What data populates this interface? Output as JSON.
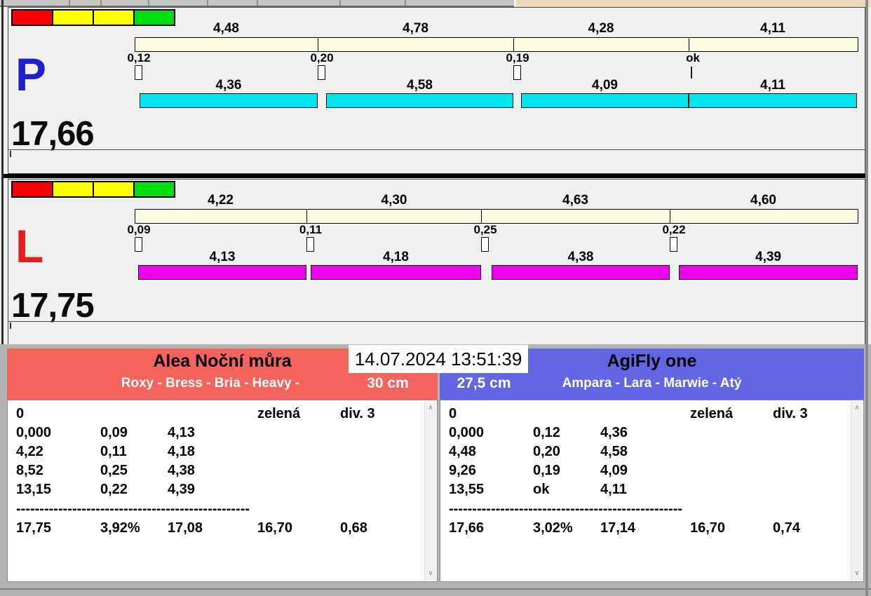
{
  "meta": {
    "datetime": "14.07.2024 13:51:39"
  },
  "icons": {
    "scroll_up": "∧",
    "scroll_down": "∨"
  },
  "colors": {
    "cream_bar": "#fdfce1",
    "cyan_bar": "#00e4ee",
    "magenta_bar": "#ee00ee",
    "team_left_header": "#f4635c",
    "team_right_header": "#6366e3",
    "p_label": "#1f1fcc",
    "l_label": "#e01f1f",
    "traffic": [
      "#f70000",
      "#ffff00",
      "#ffff00",
      "#00dd11"
    ],
    "top_strip_tan": "#ecd8ba"
  },
  "run_panels": [
    {
      "label": "P",
      "total": "17,66",
      "total_value": 17.66,
      "bar_color_key": "cyan_bar",
      "segments": [
        {
          "split": "4,48",
          "split_value": 4.48,
          "change": "0,12",
          "change_value": 0.12,
          "run": "4,36",
          "run_value": 4.36
        },
        {
          "split": "4,78",
          "split_value": 4.78,
          "change": "0,20",
          "change_value": 0.2,
          "run": "4,58",
          "run_value": 4.58
        },
        {
          "split": "4,28",
          "split_value": 4.28,
          "change": "0,19",
          "change_value": 0.19,
          "run": "4,09",
          "run_value": 4.09
        },
        {
          "split": "4,11",
          "split_value": 4.11,
          "change": "ok",
          "change_value": 0,
          "run": "4,11",
          "run_value": 4.11
        }
      ]
    },
    {
      "label": "L",
      "total": "17,75",
      "total_value": 17.75,
      "bar_color_key": "magenta_bar",
      "segments": [
        {
          "split": "4,22",
          "split_value": 4.22,
          "change": "0,09",
          "change_value": 0.09,
          "run": "4,13",
          "run_value": 4.13
        },
        {
          "split": "4,30",
          "split_value": 4.3,
          "change": "0,11",
          "change_value": 0.11,
          "run": "4,18",
          "run_value": 4.18
        },
        {
          "split": "4,63",
          "split_value": 4.63,
          "change": "0,25",
          "change_value": 0.25,
          "run": "4,38",
          "run_value": 4.38
        },
        {
          "split": "4,60",
          "split_value": 4.6,
          "change": "0,22",
          "change_value": 0.22,
          "run": "4,39",
          "run_value": 4.39
        }
      ]
    }
  ],
  "teams": [
    {
      "name": "Alea Noční můra",
      "members": "Roxy - Bress - Bria - Heavy -",
      "height_class": "30 cm",
      "table": {
        "rows": [
          [
            "0",
            "",
            "",
            "zelená",
            "div. 3"
          ],
          [
            "0,000",
            "0,09",
            "4,13",
            "",
            ""
          ],
          [
            "4,22",
            "0,11",
            "4,18",
            "",
            ""
          ],
          [
            "8,52",
            "0,25",
            "4,38",
            "",
            ""
          ],
          [
            "13,15",
            "0,22",
            "4,39",
            "",
            ""
          ]
        ],
        "separator": "--------------------------------------------------",
        "summary": [
          "17,75",
          "3,92%",
          "17,08",
          "16,70",
          "0,68"
        ]
      }
    },
    {
      "name": "AgiFly one",
      "members": "Ampara - Lara - Marwie - Atý",
      "height_class": "27,5 cm",
      "table": {
        "rows": [
          [
            "0",
            "",
            "",
            "zelená",
            "div. 3"
          ],
          [
            "0,000",
            "0,12",
            "4,36",
            "",
            ""
          ],
          [
            "4,48",
            "0,20",
            "4,58",
            "",
            ""
          ],
          [
            "9,26",
            "0,19",
            "4,09",
            "",
            ""
          ],
          [
            "13,55",
            "ok",
            "4,11",
            "",
            ""
          ]
        ],
        "separator": "--------------------------------------------------",
        "summary": [
          "17,66",
          "3,02%",
          "17,14",
          "16,70",
          "0,74"
        ]
      }
    }
  ]
}
